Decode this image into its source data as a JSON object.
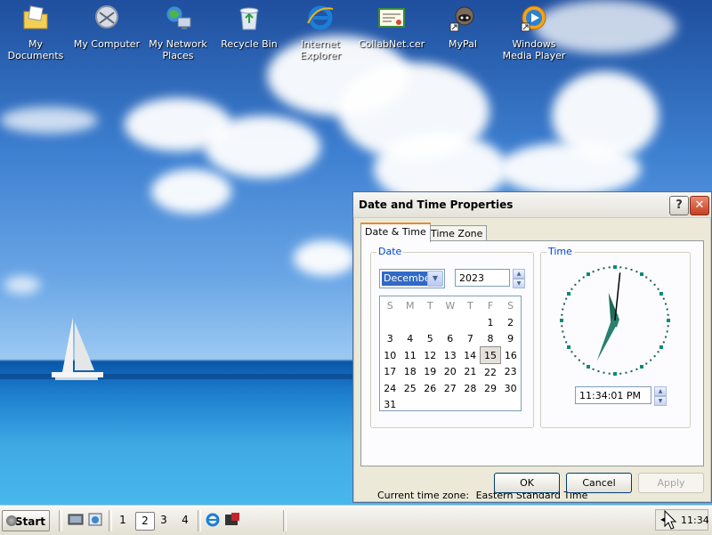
{
  "desktop_icons": [
    {
      "label": "My Documents",
      "icon": "folder-documents-icon"
    },
    {
      "label": "My Computer",
      "icon": "computer-icon"
    },
    {
      "label": "My Network Places",
      "icon": "network-icon"
    },
    {
      "label": "Recycle Bin",
      "icon": "recycle-bin-icon"
    },
    {
      "label": "Internet Explorer",
      "icon": "internet-explorer-icon"
    },
    {
      "label": "CollabNet.cer",
      "icon": "certificate-icon"
    },
    {
      "label": "MyPal",
      "icon": "mypal-icon"
    },
    {
      "label": "Windows Media Player",
      "icon": "media-player-icon"
    }
  ],
  "dialog": {
    "title": "Date and Time Properties",
    "help_label": "?",
    "close_label": "✕",
    "tabs": [
      {
        "label": "Date & Time"
      },
      {
        "label": "Time Zone"
      }
    ],
    "date_group_label": "Date",
    "month": "December",
    "year": "2023",
    "weekday_headers": [
      "S",
      "M",
      "T",
      "W",
      "T",
      "F",
      "S"
    ],
    "calendar_weeks": [
      [
        "",
        "",
        "",
        "",
        "",
        "1",
        "2"
      ],
      [
        "3",
        "4",
        "5",
        "6",
        "7",
        "8",
        "9"
      ],
      [
        "10",
        "11",
        "12",
        "13",
        "14",
        "15",
        "16"
      ],
      [
        "17",
        "18",
        "19",
        "20",
        "21",
        "22",
        "23"
      ],
      [
        "24",
        "25",
        "26",
        "27",
        "28",
        "29",
        "30"
      ],
      [
        "31",
        "",
        "",
        "",
        "",
        "",
        ""
      ]
    ],
    "selected_day": "15",
    "time_group_label": "Time",
    "time_value": "11:34:01 PM",
    "clock_hours": 23,
    "clock_minutes": 34,
    "clock_seconds": 1,
    "current_tz_label": "Current time zone:",
    "current_tz_value": "Eastern Standard Time",
    "ok_label": "OK",
    "cancel_label": "Cancel",
    "apply_label": "Apply"
  },
  "taskbar": {
    "start_label": "Start",
    "workspaces": [
      "1",
      "2",
      "3",
      "4"
    ],
    "active_workspace": "2",
    "clock": "11:34"
  },
  "colors": {
    "accent_blue": "#0046d5",
    "clock_hand": "#1f6b5a",
    "tab_highlight": "#e68b2c"
  }
}
